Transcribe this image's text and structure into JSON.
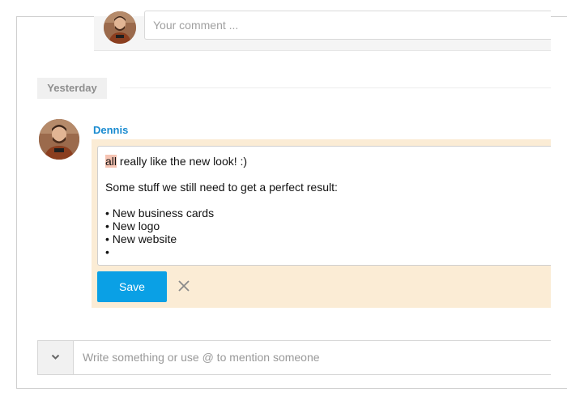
{
  "top_comment": {
    "placeholder": "Your comment ..."
  },
  "separator": {
    "date_label": "Yesterday"
  },
  "post": {
    "author": "Dennis",
    "editor": {
      "mention_text": "all",
      "first_line_rest": " really like the new look! :)",
      "intro_line": "Some stuff we still need to get a perfect result:",
      "bullets": [
        "• New business cards",
        "• New logo",
        "• New website",
        "•"
      ]
    },
    "save_label": "Save"
  },
  "composer": {
    "placeholder": "Write something or use @ to mention someone"
  },
  "icons": {
    "close": "close-icon",
    "dropdown": "chevron-down-icon"
  },
  "colors": {
    "accent": "#0aa0e5",
    "author": "#1a8bd0",
    "edit_bg": "#fbecd5",
    "mention_bg": "#f6c4b3"
  }
}
